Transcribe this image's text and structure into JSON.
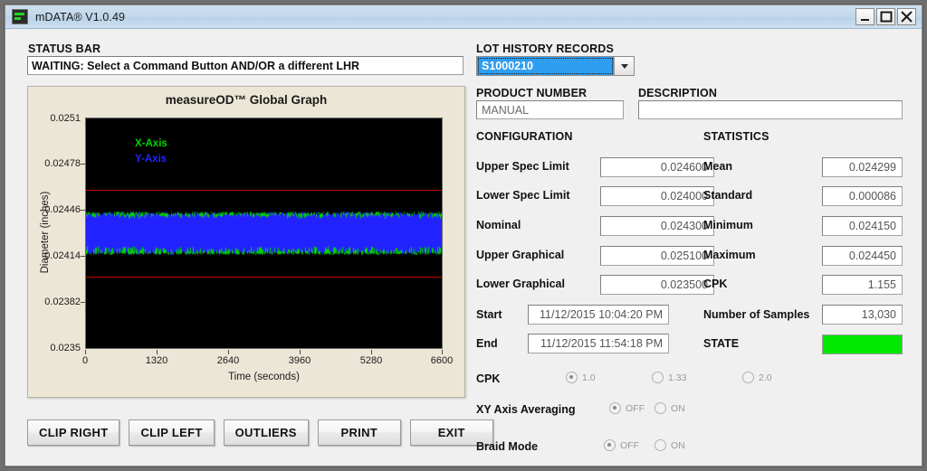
{
  "window": {
    "title": "mDATA® V1.0.49",
    "icon": "app-icon",
    "controls": {
      "minimize": "minimize",
      "maximize": "maximize",
      "close": "close"
    }
  },
  "status": {
    "label": "STATUS BAR",
    "value": "WAITING: Select a Command Button AND/OR a different LHR"
  },
  "graph": {
    "title": "measureOD™ Global Graph",
    "legend": [
      {
        "name": "X-Axis",
        "color": "#00d400"
      },
      {
        "name": "Y-Axis",
        "color": "#2222ff"
      }
    ],
    "y_axis_title": "Diameter (inches)",
    "x_axis_title": "Time (seconds)",
    "y_ticks": [
      "0.0251",
      "0.02478",
      "0.02446",
      "0.02414",
      "0.02382",
      "0.0235"
    ],
    "x_ticks": [
      "0",
      "1320",
      "2640",
      "3960",
      "5280",
      "6600"
    ]
  },
  "chart_data": {
    "type": "line",
    "title": "measureOD™ Global Graph",
    "xlabel": "Time (seconds)",
    "ylabel": "Diameter (inches)",
    "xlim": [
      0,
      6600
    ],
    "ylim": [
      0.0235,
      0.0251
    ],
    "xticks": [
      0,
      1320,
      2640,
      3960,
      5280,
      6600
    ],
    "yticks": [
      0.0235,
      0.02382,
      0.02414,
      0.02446,
      0.02478,
      0.0251
    ],
    "grid": false,
    "legend_position": "top-left",
    "background": "#000000",
    "series": [
      {
        "name": "X-Axis",
        "color": "#00d400",
        "description": "Green trace overlaid on blue band, spanning approx 0.024150 to 0.024450 inches",
        "min": 0.02415,
        "max": 0.02445,
        "mean": 0.024299
      },
      {
        "name": "Y-Axis",
        "color": "#2222ff",
        "description": "Dense blue band of 13,030 samples filling approx 0.024150 to 0.024450 inches",
        "min": 0.02415,
        "max": 0.02445,
        "mean": 0.024299
      }
    ],
    "reference_lines": [
      {
        "name": "Upper Spec Limit",
        "value": 0.0246,
        "color": "#c00000"
      },
      {
        "name": "Lower Spec Limit",
        "value": 0.024,
        "color": "#c00000"
      }
    ]
  },
  "commands": [
    {
      "label": "CLIP RIGHT",
      "name": "clip-right-button"
    },
    {
      "label": "CLIP LEFT",
      "name": "clip-left-button"
    },
    {
      "label": "OUTLIERS",
      "name": "outliers-button"
    },
    {
      "label": "PRINT",
      "name": "print-button"
    },
    {
      "label": "EXIT",
      "name": "exit-button"
    }
  ],
  "lot_history": {
    "label": "LOT HISTORY RECORDS",
    "selected": "S1000210"
  },
  "product": {
    "label": "PRODUCT NUMBER",
    "value": "MANUAL"
  },
  "description": {
    "label": "DESCRIPTION",
    "value": ""
  },
  "configuration": {
    "header": "CONFIGURATION",
    "rows": [
      {
        "label": "Upper Spec Limit",
        "value": "0.024600"
      },
      {
        "label": "Lower Spec Limit",
        "value": "0.024000"
      },
      {
        "label": "Nominal",
        "value": "0.024300"
      },
      {
        "label": "Upper Graphical",
        "value": "0.025100"
      },
      {
        "label": "Lower Graphical",
        "value": "0.023500"
      }
    ],
    "start": {
      "label": "Start",
      "value": "11/12/2015 10:04:20 PM"
    },
    "end": {
      "label": "End",
      "value": "11/12/2015 11:54:18 PM"
    },
    "cpk_group": {
      "label": "CPK",
      "options": [
        {
          "label": "1.0",
          "selected": true
        },
        {
          "label": "1.33",
          "selected": false
        },
        {
          "label": "2.0",
          "selected": false
        }
      ]
    },
    "xy_averaging_group": {
      "label": "XY Axis Averaging",
      "options": [
        {
          "label": "OFF",
          "selected": true
        },
        {
          "label": "ON",
          "selected": false
        }
      ]
    },
    "braid_mode_group": {
      "label": "Braid Mode",
      "options": [
        {
          "label": "OFF",
          "selected": true
        },
        {
          "label": "ON",
          "selected": false
        }
      ]
    }
  },
  "statistics": {
    "header": "STATISTICS",
    "rows": [
      {
        "label": "Mean",
        "value": "0.024299"
      },
      {
        "label": "Standard",
        "value": "0.000086"
      },
      {
        "label": "Minimum",
        "value": "0.024150"
      },
      {
        "label": "Maximum",
        "value": "0.024450"
      },
      {
        "label": "CPK",
        "value": "1.155"
      },
      {
        "label": "Number of Samples",
        "value": "13,030"
      }
    ],
    "state": {
      "label": "STATE",
      "color": "#00e800"
    }
  }
}
